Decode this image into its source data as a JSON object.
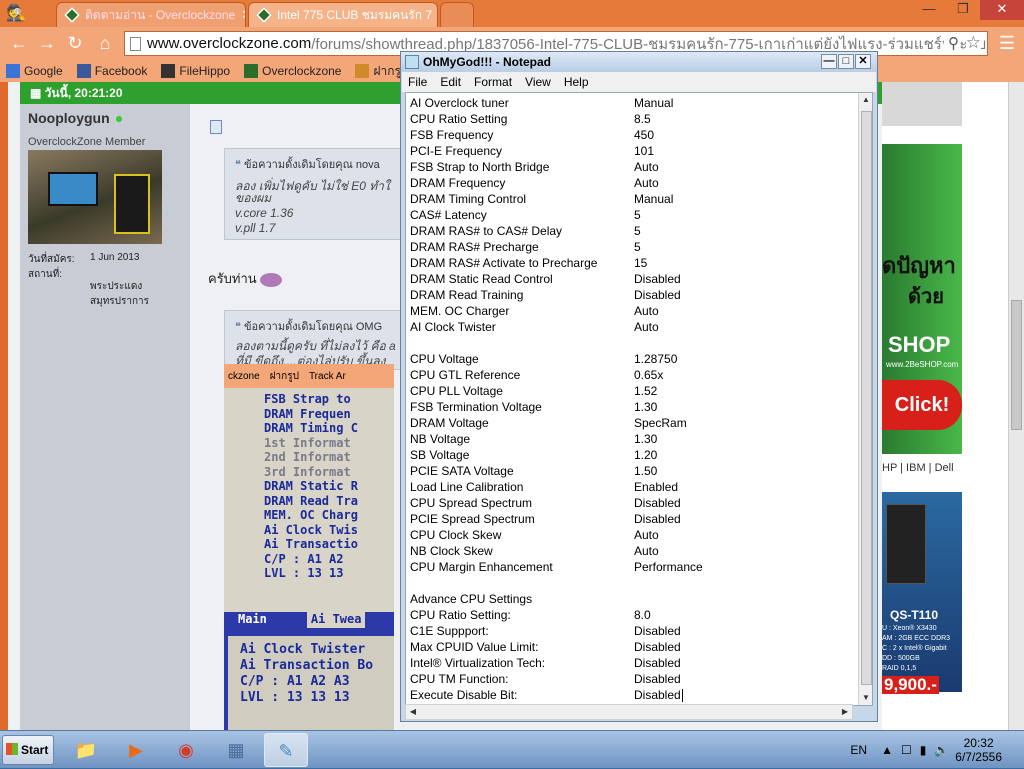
{
  "browser": {
    "tabs": [
      {
        "label": "ติดตามอ่าน - Overclockzone",
        "active": false
      },
      {
        "label": "Intel 775 CLUB ชมรมคนรัก 7",
        "active": true
      }
    ],
    "url_host": "www.overclockzone.com",
    "url_path": "/forums/showthread.php/1837056-Intel-775-CLUB-ชมรมคนรัก-775-เกาเก่าแต่ยังไฟแรง-ร่วมแชร์ประสบการณ",
    "bookmarks": [
      {
        "label": "Google",
        "icon": "google-icon",
        "color": "#3b73d9"
      },
      {
        "label": "Facebook",
        "icon": "facebook-icon",
        "color": "#3b5998"
      },
      {
        "label": "FileHippo",
        "icon": "filehippo-icon",
        "color": "#333333"
      },
      {
        "label": "Overclockzone",
        "icon": "overclockzone-icon",
        "color": "#2a6e2a"
      },
      {
        "label": "ฝากรูป",
        "icon": "photo-icon",
        "color": "#d08a2a"
      }
    ]
  },
  "forum": {
    "date_bar": "วันนี้, 20:21:20",
    "username": "Nooploygun",
    "user_role": "OverclockZone Member",
    "join_label": "วันที่สมัคร:",
    "join_value": "1 Jun 2013",
    "location_label": "สถานที่:",
    "location_value": "พระประแดง สมุทรปราการ",
    "quote1_header": "ข้อความดั้งเดิมโดยคุณ nova",
    "quote1_lines": [
      "ลอง เพิ่มไฟดูคับ ไม่ใช่ E0 ทำใ",
      "ของผม",
      "v.core 1.36",
      "v.pll 1.7"
    ],
    "reply_text": "ครับท่าน",
    "quote2_header": "ข้อความดั้งเดิมโดยคุณ OMG",
    "quote2_lines": [
      "ลองตามนี้ดูครับ ที่ไม่ลงไว้ คือ a",
      "ที่มี ขีดถึง....ต่องไล่ปรับ ขึ้นลง"
    ],
    "photo_bookmarks": [
      "ckzone",
      "ฝากรูป",
      "Track Ar"
    ],
    "photo_lines": [
      "FSB Strap to",
      "DRAM Frequen",
      "DRAM Timing C",
      "1st Informat",
      "2nd Informat",
      "3rd Informat",
      "DRAM Static R",
      "DRAM Read Tra",
      "MEM. OC Charg",
      "Ai Clock Twis",
      "Ai Transactio",
      "C/P : A1 A2",
      "LVL : 13 13"
    ],
    "photo_tabs": [
      "Main",
      "Ai Twea"
    ],
    "photo_bottom": [
      "Ai Clock Twister",
      "Ai Transaction Bo",
      "C/P : A1 A2 A3",
      "LVL : 13 13 13"
    ],
    "sidebar_ad_line1": "ดปัญหา",
    "sidebar_ad_line2": "ด้วย",
    "sidebar_ad_shop": "SHOP",
    "sidebar_ad_url": "www.2BeSHOP.com",
    "sidebar_click": "Click!",
    "sidebar_links": "HP | IBM | Dell",
    "server_model": "QS-T110",
    "server_specs": [
      "U : Xeon® X3430",
      "AM : 2GB ECC DDR3",
      "C : 2 x Intel® Gigabit",
      "DD : 500GB",
      "RAID 0,1,5"
    ],
    "server_price": "9,900.-"
  },
  "notepad": {
    "title": "OhMyGod!!! - Notepad",
    "menu": [
      "File",
      "Edit",
      "Format",
      "View",
      "Help"
    ],
    "lines": [
      [
        "AI Overclock tuner",
        "Manual"
      ],
      [
        "CPU Ratio Setting",
        "8.5"
      ],
      [
        "FSB Frequency",
        "450"
      ],
      [
        "PCI-E Frequency",
        "101"
      ],
      [
        "FSB Strap to North Bridge",
        "Auto"
      ],
      [
        "DRAM Frequency",
        "Auto"
      ],
      [
        "DRAM Timing Control",
        "Manual"
      ],
      [
        "CAS# Latency",
        "5"
      ],
      [
        "DRAM RAS# to CAS# Delay",
        "5"
      ],
      [
        "DRAM RAS# Precharge",
        "5"
      ],
      [
        "DRAM RAS# Activate to Precharge",
        "15"
      ],
      [
        "DRAM Static Read Control",
        "Disabled"
      ],
      [
        "DRAM Read Training",
        "Disabled"
      ],
      [
        "MEM. OC Charger",
        "Auto"
      ],
      [
        "AI Clock Twister",
        "Auto"
      ],
      [
        "",
        ""
      ],
      [
        "CPU Voltage",
        "1.28750"
      ],
      [
        "CPU GTL Reference",
        "0.65x"
      ],
      [
        "CPU PLL Voltage",
        "1.52"
      ],
      [
        "FSB Termination Voltage",
        "1.30"
      ],
      [
        "DRAM Voltage",
        "SpecRam"
      ],
      [
        "NB Voltage",
        "1.30"
      ],
      [
        "SB Voltage",
        "1.20"
      ],
      [
        "PCIE SATA Voltage",
        "1.50"
      ],
      [
        "Load Line Calibration",
        "Enabled"
      ],
      [
        "CPU Spread Spectrum",
        "Disabled"
      ],
      [
        "PCIE Spread Spectrum",
        "Disabled"
      ],
      [
        "CPU Clock Skew",
        "Auto"
      ],
      [
        "NB Clock Skew",
        "Auto"
      ],
      [
        "CPU Margin Enhancement",
        "Performance"
      ],
      [
        "",
        ""
      ],
      [
        "Advance CPU Settings",
        ""
      ],
      [
        "CPU Ratio Setting:",
        "8.0"
      ],
      [
        "C1E Suppport:",
        "Disabled"
      ],
      [
        "Max CPUID Value Limit:",
        "Disabled"
      ],
      [
        "Intel® Virtualization Tech:",
        "Disabled"
      ],
      [
        "CPU TM Function:",
        "Disabled"
      ],
      [
        "Execute Disable Bit:",
        "Disabled"
      ]
    ]
  },
  "taskbar": {
    "start_label": "Start",
    "language": "EN",
    "time": "20:32",
    "date": "6/7/2556"
  }
}
